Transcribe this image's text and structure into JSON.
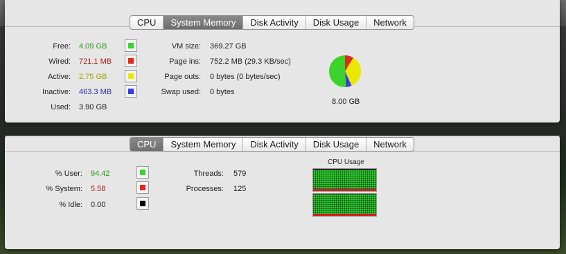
{
  "colors": {
    "free": "#3ad42a",
    "wired": "#e02a1a",
    "active": "#e8e800",
    "inactive": "#3a3aee",
    "user": "#3ad42a",
    "system": "#e02a1a",
    "idle": "#000000"
  },
  "memory": {
    "tabs": [
      "CPU",
      "System Memory",
      "Disk Activity",
      "Disk Usage",
      "Network"
    ],
    "selected_tab": "System Memory",
    "free": {
      "label": "Free:",
      "value": "4.09 GB"
    },
    "wired": {
      "label": "Wired:",
      "value": "721.1 MB"
    },
    "active": {
      "label": "Active:",
      "value": "2.75 GB"
    },
    "inactive": {
      "label": "Inactive:",
      "value": "463.3 MB"
    },
    "used": {
      "label": "Used:",
      "value": "3.90 GB"
    },
    "vm_size": {
      "label": "VM size:",
      "value": "369.27 GB"
    },
    "page_ins": {
      "label": "Page ins:",
      "value": "752.2 MB (29.3 KB/sec)"
    },
    "page_outs": {
      "label": "Page outs:",
      "value": "0 bytes (0 bytes/sec)"
    },
    "swap_used": {
      "label": "Swap used:",
      "value": "0 bytes"
    },
    "total": "8.00 GB",
    "pie_fractions": {
      "free": 0.511,
      "wired": 0.088,
      "active": 0.344,
      "inactive": 0.057
    }
  },
  "cpu": {
    "tabs": [
      "CPU",
      "System Memory",
      "Disk Activity",
      "Disk Usage",
      "Network"
    ],
    "selected_tab": "CPU",
    "user": {
      "label": "% User:",
      "value": "94.42"
    },
    "system": {
      "label": "% System:",
      "value": "5.58"
    },
    "idle": {
      "label": "% Idle:",
      "value": "0.00"
    },
    "threads": {
      "label": "Threads:",
      "value": "579"
    },
    "processes": {
      "label": "Processes:",
      "value": "125"
    },
    "graph_title": "CPU Usage",
    "core_usage": [
      0.94,
      0.97
    ]
  }
}
